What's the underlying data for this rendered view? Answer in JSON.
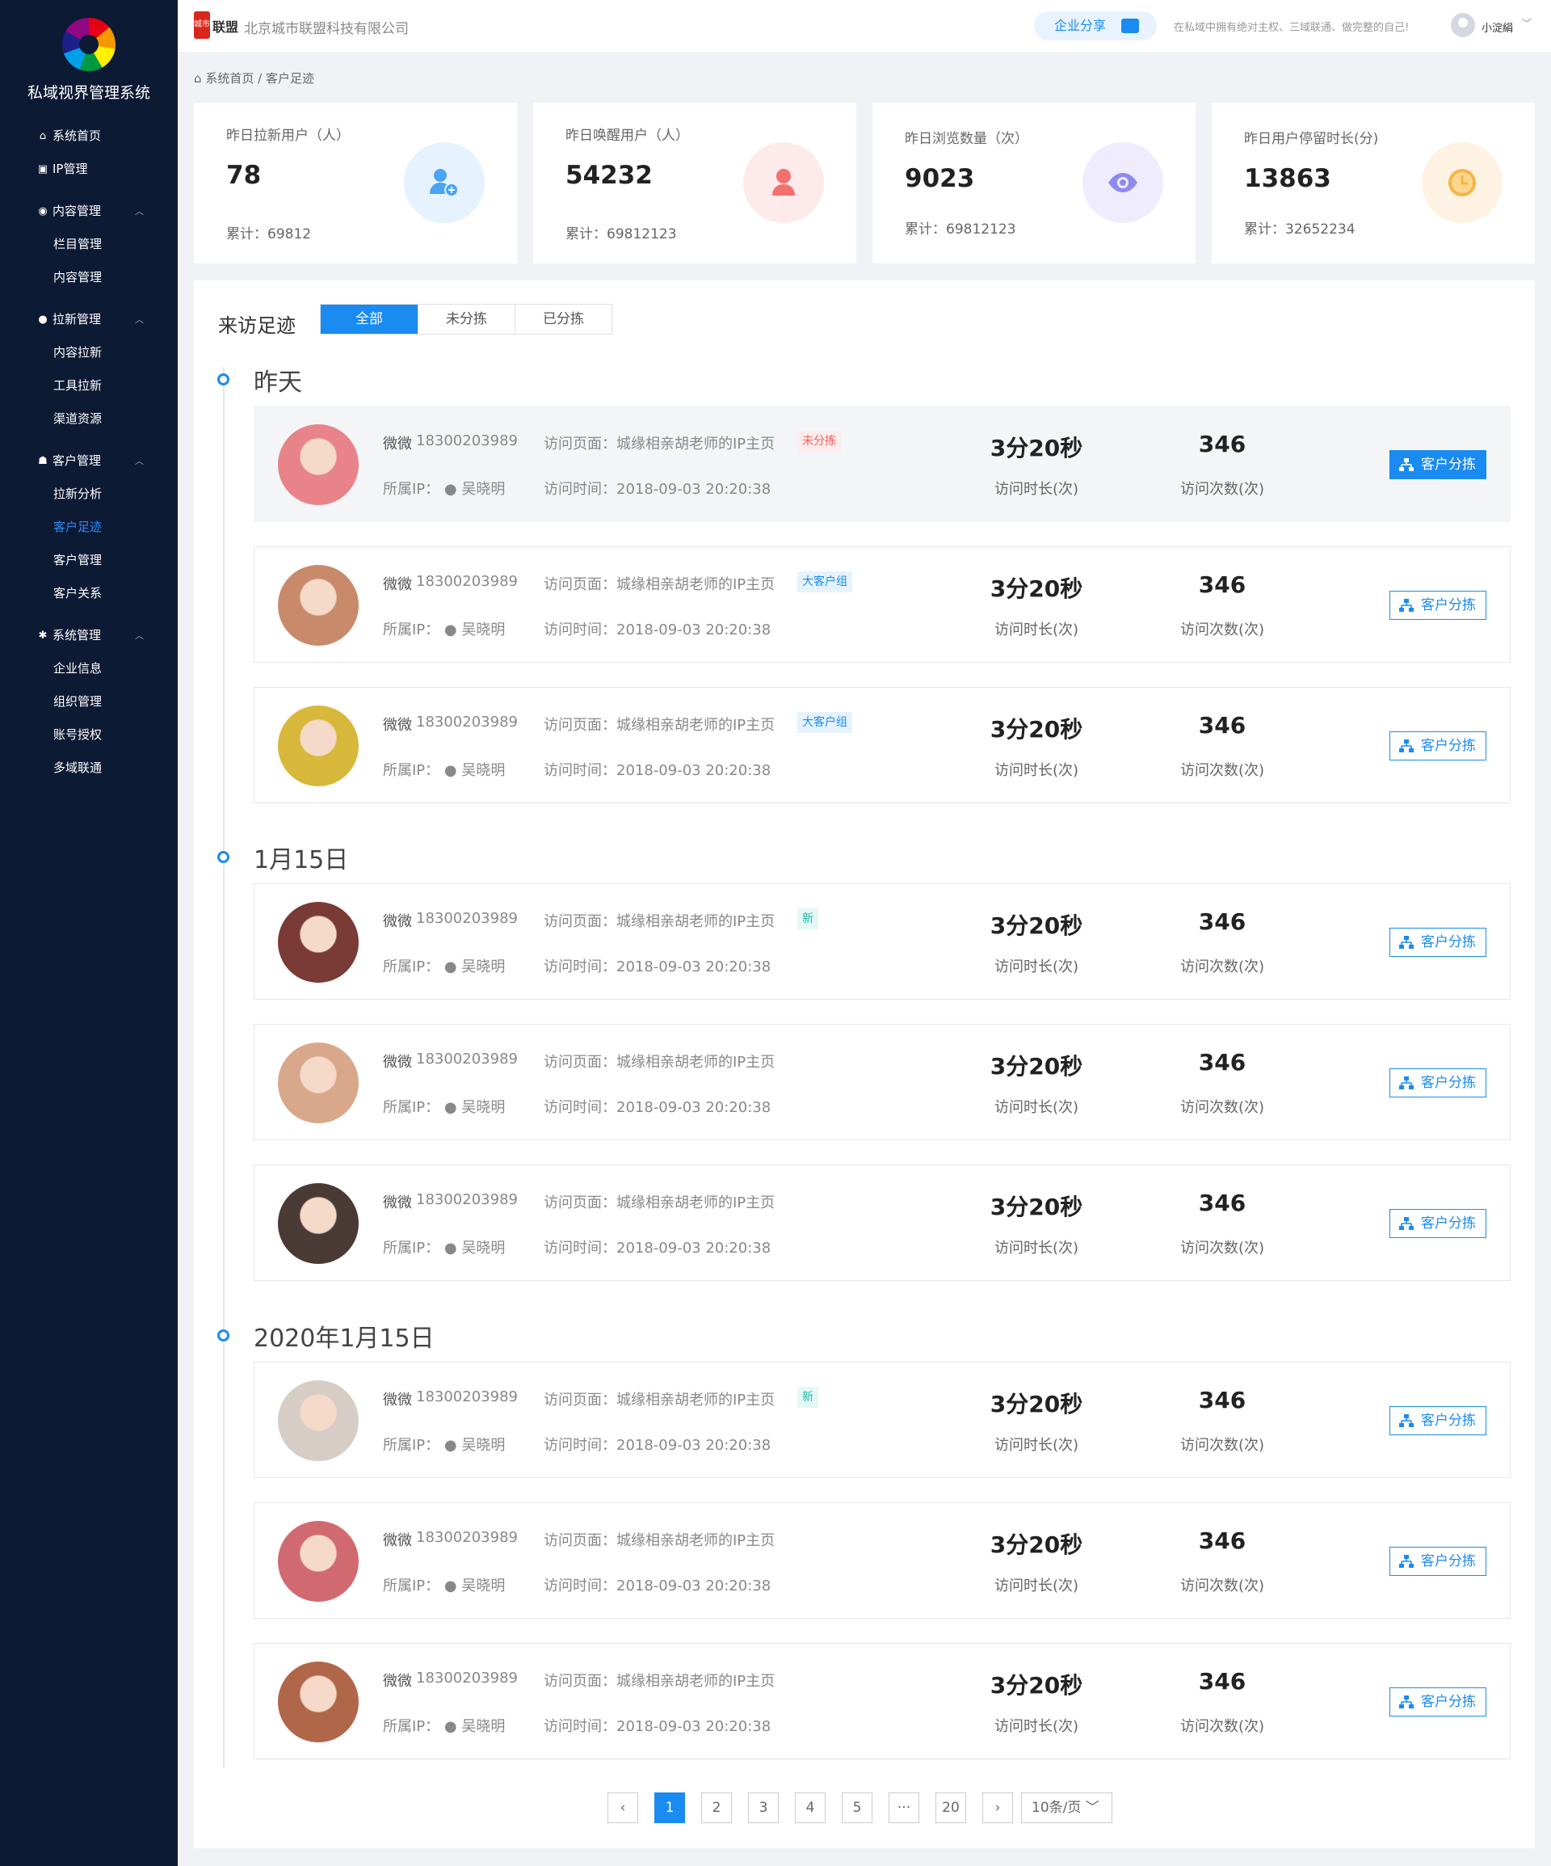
{
  "sidebar": {
    "brand": "私域视界管理系统",
    "items": [
      {
        "label": "系统首页",
        "icon": "home-icon",
        "glyph": "⌂"
      },
      {
        "label": "IP管理",
        "icon": "monitor-icon",
        "glyph": "▣"
      },
      {
        "label": "内容管理",
        "icon": "layers-icon",
        "glyph": "◉",
        "arrow": "︿"
      },
      {
        "label": "栏目管理"
      },
      {
        "label": "内容管理"
      },
      {
        "label": "拉新管理",
        "icon": "user-icon",
        "glyph": "●",
        "arrow": "︿"
      },
      {
        "label": "内容拉新"
      },
      {
        "label": "工具拉新"
      },
      {
        "label": "渠道资源"
      },
      {
        "label": "客户管理",
        "icon": "users-icon",
        "glyph": "☗",
        "arrow": "︿"
      },
      {
        "label": "拉新分析"
      },
      {
        "label": "客户足迹"
      },
      {
        "label": "客户管理"
      },
      {
        "label": "客户关系"
      },
      {
        "label": "系统管理",
        "icon": "gear-icon",
        "glyph": "✱",
        "arrow": "︿"
      },
      {
        "label": "企业信息"
      },
      {
        "label": "组织管理"
      },
      {
        "label": "账号授权"
      },
      {
        "label": "多域联通"
      }
    ]
  },
  "topbar": {
    "logo_text": "城市",
    "brand": "联盟",
    "company": "北京城市联盟科技有限公司",
    "share": "企业分享",
    "slogan": "在私域中拥有绝对主权、三域联通、做完整的自己!",
    "user": "小淀絹",
    "arrow": "﹀"
  },
  "breadcrumb": {
    "home": "系统首页",
    "sep": "/",
    "current": "客户足迹"
  },
  "stats": [
    {
      "label": "昨日拉新用户（人）",
      "value": "78",
      "total_label": "累计：",
      "total": "69812",
      "icon": "user-add-icon",
      "color": "#4aa3f5",
      "bg": "#e6f2fe"
    },
    {
      "label": "昨日唤醒用户（人）",
      "value": "54232",
      "total_label": "累计：",
      "total": "69812123",
      "icon": "user-icon",
      "color": "#f46f6f",
      "bg": "#fdeaea"
    },
    {
      "label": "昨日浏览数量（次）",
      "value": "9023",
      "total_label": "累计：",
      "total": "69812123",
      "icon": "eye-icon",
      "color": "#8f8af0",
      "bg": "#eeecfd"
    },
    {
      "label": "昨日用户停留时长(分)",
      "value": "13863",
      "total_label": "累计：",
      "total": "32652234",
      "icon": "clock-icon",
      "color": "#f5b547",
      "bg": "#fef3e2"
    }
  ],
  "panel": {
    "title": "来访足迹",
    "tabs": [
      "全部",
      "未分拣",
      "已分拣"
    ],
    "active_tab": 0
  },
  "groups": [
    {
      "label": "昨天"
    },
    {
      "label": "1月15日"
    },
    {
      "label": "2020年1月15日"
    }
  ],
  "record_labels": {
    "page_prefix": "访问页面：",
    "time_prefix": "访问时间：",
    "owner_prefix": "所属IP：",
    "duration_label": "访问时长(次)",
    "count_label": "访问次数(次)",
    "button": "客户分拣"
  },
  "records": [
    {
      "name": "微微",
      "phone": "18300203989",
      "page": "城缘相亲胡老师的IP主页",
      "owner": "吴晓明",
      "time": "2018-09-03 20:20:38",
      "tag": "未分拣",
      "tag_style": "red",
      "duration": "3分20秒",
      "count": "346",
      "avatar_color": "#e8838a"
    },
    {
      "name": "微微",
      "phone": "18300203989",
      "page": "城缘相亲胡老师的IP主页",
      "owner": "吴晓明",
      "time": "2018-09-03 20:20:38",
      "tag": "大客户组",
      "tag_style": "blue",
      "duration": "3分20秒",
      "count": "346",
      "avatar_color": "#c98a6c"
    },
    {
      "name": "微微",
      "phone": "18300203989",
      "page": "城缘相亲胡老师的IP主页",
      "owner": "吴晓明",
      "time": "2018-09-03 20:20:38",
      "tag": "大客户组",
      "tag_style": "blue",
      "duration": "3分20秒",
      "count": "346",
      "avatar_color": "#d8b83a"
    },
    {
      "name": "微微",
      "phone": "18300203989",
      "page": "城缘相亲胡老师的IP主页",
      "owner": "吴晓明",
      "time": "2018-09-03 20:20:38",
      "tag": "新",
      "tag_style": "cyan",
      "duration": "3分20秒",
      "count": "346",
      "avatar_color": "#7a3a36"
    },
    {
      "name": "微微",
      "phone": "18300203989",
      "page": "城缘相亲胡老师的IP主页",
      "owner": "吴晓明",
      "time": "2018-09-03 20:20:38",
      "tag": "",
      "tag_style": "",
      "duration": "3分20秒",
      "count": "346",
      "avatar_color": "#d9a78a"
    },
    {
      "name": "微微",
      "phone": "18300203989",
      "page": "城缘相亲胡老师的IP主页",
      "owner": "吴晓明",
      "time": "2018-09-03 20:20:38",
      "tag": "",
      "tag_style": "",
      "duration": "3分20秒",
      "count": "346",
      "avatar_color": "#4a3a36"
    },
    {
      "name": "微微",
      "phone": "18300203989",
      "page": "城缘相亲胡老师的IP主页",
      "owner": "吴晓明",
      "time": "2018-09-03 20:20:38",
      "tag": "新",
      "tag_style": "cyan",
      "duration": "3分20秒",
      "count": "346",
      "avatar_color": "#d6cdc6"
    },
    {
      "name": "微微",
      "phone": "18300203989",
      "page": "城缘相亲胡老师的IP主页",
      "owner": "吴晓明",
      "time": "2018-09-03 20:20:38",
      "tag": "",
      "tag_style": "",
      "duration": "3分20秒",
      "count": "346",
      "avatar_color": "#d06a70"
    },
    {
      "name": "微微",
      "phone": "18300203989",
      "page": "城缘相亲胡老师的IP主页",
      "owner": "吴晓明",
      "time": "2018-09-03 20:20:38",
      "tag": "",
      "tag_style": "",
      "duration": "3分20秒",
      "count": "346",
      "avatar_color": "#b06648"
    }
  ],
  "pagination": {
    "prev": "‹",
    "next": "›",
    "pages": [
      "1",
      "2",
      "3",
      "4",
      "5",
      "···",
      "20"
    ],
    "current": "1",
    "page_size": "10条/页",
    "caret": "﹀"
  },
  "colors": {
    "primary": "#1a8bf0",
    "sidebar_bg": "#0d1a34"
  }
}
